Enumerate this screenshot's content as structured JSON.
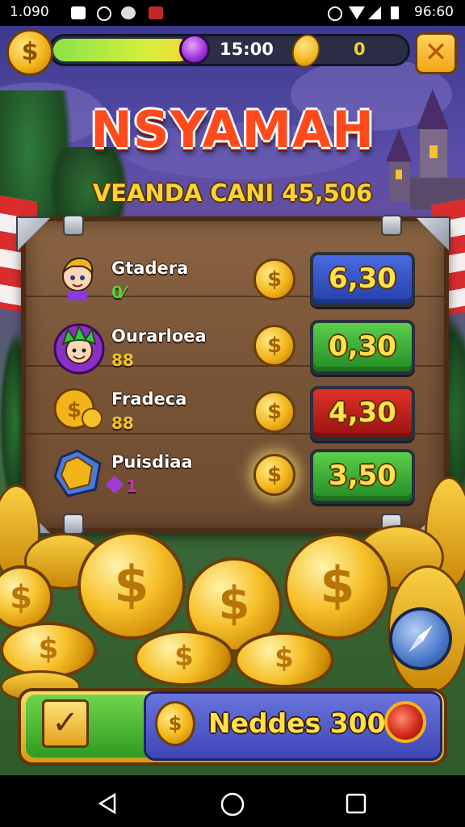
{
  "status_bar": {
    "left_text": "1.090",
    "time": "96:60"
  },
  "hud": {
    "timer": "15:00",
    "coin_count": "0",
    "close_icon": "close-icon"
  },
  "title": "NSYAMAH",
  "subtitle": "VEANDA CANI 45,506",
  "rows": [
    {
      "name": "Gtadera",
      "sub": "0⁄",
      "sub_color": "#5fd03a",
      "coin": "$",
      "price": "6,30",
      "price_color": "#2e4fc4",
      "icon": "boy-avatar-icon"
    },
    {
      "name": "Ourarloea",
      "sub": "88",
      "sub_color": "#f2c230",
      "coin": "$",
      "price": "0,30",
      "price_color": "#2ea23a",
      "icon": "green-hair-avatar-icon"
    },
    {
      "name": "Fradeca",
      "sub": "88",
      "sub_color": "#f2c230",
      "coin": "$",
      "price": "4,30",
      "price_color": "#c0201a",
      "icon": "coins-icon"
    },
    {
      "name": "Puisdiaa",
      "sub": "1",
      "sub_color": "#c03aa8",
      "coin": "$",
      "price": "3,50",
      "price_color": "#2ea23a",
      "icon": "gold-chest-icon"
    }
  ],
  "bottom_bar": {
    "check_icon": "checkmark-icon",
    "need_label": "Neddes 300",
    "orb_icon": "red-gem-icon"
  },
  "colors": {
    "title": "#ff4a1c",
    "subtitle": "#f6d33a",
    "gold": "#f2b41a"
  }
}
